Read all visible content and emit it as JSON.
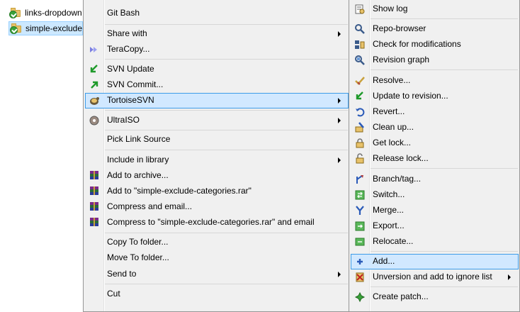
{
  "explorer": {
    "files": [
      {
        "name": "links-dropdown",
        "selected": false
      },
      {
        "name": "simple-exclude-categories",
        "selected": true
      }
    ]
  },
  "context_menu": {
    "items": [
      {
        "id": "git-bash",
        "label": "Git Bash",
        "icon": "none",
        "submenu": false
      },
      {
        "id": "share-with",
        "label": "Share with",
        "icon": "none",
        "submenu": true
      },
      {
        "id": "teracopy",
        "label": "TeraCopy...",
        "icon": "teracopy-icon",
        "submenu": false
      },
      {
        "id": "svn-update",
        "label": "SVN Update",
        "icon": "svn-update-icon",
        "submenu": false
      },
      {
        "id": "svn-commit",
        "label": "SVN Commit...",
        "icon": "svn-commit-icon",
        "submenu": false
      },
      {
        "id": "tortoisesvn",
        "label": "TortoiseSVN",
        "icon": "tortoise-icon",
        "submenu": true,
        "highlighted": true
      },
      {
        "id": "ultraiso",
        "label": "UltraISO",
        "icon": "ultraiso-icon",
        "submenu": true
      },
      {
        "id": "pick-link-source",
        "label": "Pick Link Source",
        "icon": "none",
        "submenu": false
      },
      {
        "id": "include-in-library",
        "label": "Include in library",
        "icon": "none",
        "submenu": true
      },
      {
        "id": "add-to-archive",
        "label": "Add to archive...",
        "icon": "winrar-icon",
        "submenu": false
      },
      {
        "id": "add-to-rar",
        "label": "Add to \"simple-exclude-categories.rar\"",
        "icon": "winrar-icon",
        "submenu": false
      },
      {
        "id": "compress-email",
        "label": "Compress and email...",
        "icon": "winrar-icon",
        "submenu": false
      },
      {
        "id": "compress-rar-email",
        "label": "Compress to \"simple-exclude-categories.rar\" and email",
        "icon": "winrar-icon",
        "submenu": false
      },
      {
        "id": "copy-to-folder",
        "label": "Copy To folder...",
        "icon": "none",
        "submenu": false
      },
      {
        "id": "move-to-folder",
        "label": "Move To folder...",
        "icon": "none",
        "submenu": false
      },
      {
        "id": "send-to",
        "label": "Send to",
        "icon": "none",
        "submenu": true
      },
      {
        "id": "cut",
        "label": "Cut",
        "icon": "none",
        "submenu": false
      }
    ]
  },
  "tortoise_submenu": {
    "items": [
      {
        "id": "show-log",
        "label": "Show log",
        "icon": "show-log-icon",
        "submenu": false
      },
      {
        "id": "repo-browser",
        "label": "Repo-browser",
        "icon": "repo-browser-icon",
        "submenu": false
      },
      {
        "id": "check-modifications",
        "label": "Check for modifications",
        "icon": "check-modifications-icon",
        "submenu": false
      },
      {
        "id": "revision-graph",
        "label": "Revision graph",
        "icon": "revision-graph-icon",
        "submenu": false
      },
      {
        "id": "resolve",
        "label": "Resolve...",
        "icon": "resolve-icon",
        "submenu": false
      },
      {
        "id": "update-to-revision",
        "label": "Update to revision...",
        "icon": "update-revision-icon",
        "submenu": false
      },
      {
        "id": "revert",
        "label": "Revert...",
        "icon": "revert-icon",
        "submenu": false
      },
      {
        "id": "clean-up",
        "label": "Clean up...",
        "icon": "clean-up-icon",
        "submenu": false
      },
      {
        "id": "get-lock",
        "label": "Get lock...",
        "icon": "lock-icon",
        "submenu": false
      },
      {
        "id": "release-lock",
        "label": "Release lock...",
        "icon": "unlock-icon",
        "submenu": false
      },
      {
        "id": "branch-tag",
        "label": "Branch/tag...",
        "icon": "branch-icon",
        "submenu": false
      },
      {
        "id": "switch",
        "label": "Switch...",
        "icon": "switch-icon",
        "submenu": false
      },
      {
        "id": "merge",
        "label": "Merge...",
        "icon": "merge-icon",
        "submenu": false
      },
      {
        "id": "export",
        "label": "Export...",
        "icon": "export-icon",
        "submenu": false
      },
      {
        "id": "relocate",
        "label": "Relocate...",
        "icon": "relocate-icon",
        "submenu": false
      },
      {
        "id": "add",
        "label": "Add...",
        "icon": "add-icon",
        "submenu": false,
        "highlighted": true
      },
      {
        "id": "unversion-ignore",
        "label": "Unversion and add to ignore list",
        "icon": "ignore-icon",
        "submenu": true
      },
      {
        "id": "create-patch",
        "label": "Create patch...",
        "icon": "patch-icon",
        "submenu": false
      }
    ]
  },
  "colors": {
    "menu_bg": "#f0f0f0",
    "highlight_bg": "#d1e8ff",
    "highlight_border": "#3d9ce8",
    "selection_bg": "#cce8ff"
  }
}
